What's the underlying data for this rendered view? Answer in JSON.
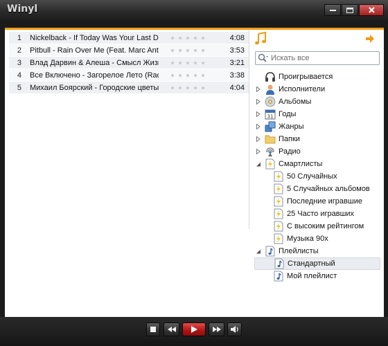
{
  "window": {
    "title": "Winyl"
  },
  "tracks": [
    {
      "num": "1",
      "title": "Nickelback - If Today Was Your Last Day",
      "duration": "4:08"
    },
    {
      "num": "2",
      "title": "Pitbull - Rain Over Me (Feat. Marc Anthony)",
      "duration": "3:53"
    },
    {
      "num": "3",
      "title": "Влад Дарвин & Алеша - Смысл Жизни",
      "duration": "3:21"
    },
    {
      "num": "4",
      "title": "Все Включено - Загорелое Лето (Radio Edit)",
      "duration": "3:38"
    },
    {
      "num": "5",
      "title": "Михаил Боярский - Городские цветы",
      "duration": "4:04"
    }
  ],
  "search": {
    "placeholder": "Искать все"
  },
  "library": {
    "now_playing": "Проигрывается",
    "artists": "Исполнители",
    "albums": "Альбомы",
    "years": "Годы",
    "genres": "Жанры",
    "folders": "Папки",
    "radio": "Радио",
    "smartlists": {
      "label": "Смартлисты",
      "items": [
        "50 Случайных",
        "5 Случайных альбомов",
        "Последние игравшие",
        "25 Часто игравших",
        "С высоким рейтингом",
        "Музыка 90х"
      ]
    },
    "playlists": {
      "label": "Плейлисты",
      "items": [
        "Стандартный",
        "Мой плейлист"
      ],
      "selected": "Стандартный"
    }
  },
  "icons": {
    "library_toggle": "music-note-icon",
    "switch_view": "arrow-right-icon",
    "stop": "stop-icon",
    "previous": "previous-icon",
    "play": "play-icon",
    "next": "next-icon",
    "volume": "speaker-icon"
  },
  "colors": {
    "accent": "#f39a12",
    "play_button": "#c81a1a",
    "chrome": "#1b1b1b"
  }
}
